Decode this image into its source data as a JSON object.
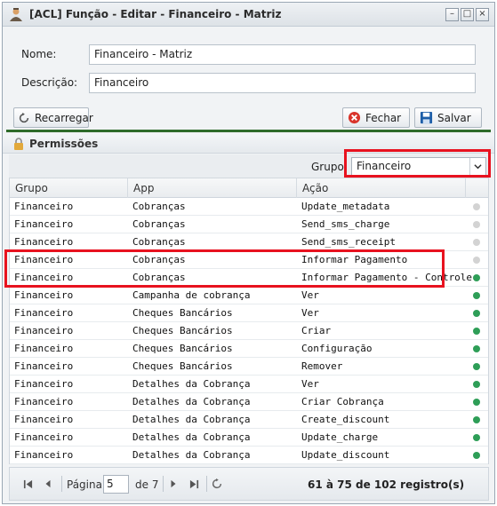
{
  "window": {
    "title": "[ACL] Função - Editar - Financeiro - Matriz",
    "controls": [
      "–",
      "□",
      "×"
    ]
  },
  "form": {
    "nome_label": "Nome:",
    "nome_value": "Financeiro - Matriz",
    "descricao_label": "Descrição:",
    "descricao_value": "Financeiro"
  },
  "toolbar": {
    "reload_label": "Recarregar",
    "close_label": "Fechar",
    "save_label": "Salvar"
  },
  "panel": {
    "title": "Permissões"
  },
  "filter": {
    "label": "Grupo:",
    "value": "Financeiro"
  },
  "columns": [
    "Grupo",
    "App",
    "Ação"
  ],
  "colors": {
    "active": "#2e9e57",
    "inactive": "#d3d3d3",
    "highlight": "#e8121f",
    "divider": "#2e6b2a"
  },
  "rows": [
    {
      "grupo": "Financeiro",
      "app": "Cobranças",
      "acao": "Update_metadata",
      "active": false
    },
    {
      "grupo": "Financeiro",
      "app": "Cobranças",
      "acao": "Send_sms_charge",
      "active": false
    },
    {
      "grupo": "Financeiro",
      "app": "Cobranças",
      "acao": "Send_sms_receipt",
      "active": false
    },
    {
      "grupo": "Financeiro",
      "app": "Cobranças",
      "acao": "Informar Pagamento",
      "active": false
    },
    {
      "grupo": "Financeiro",
      "app": "Cobranças",
      "acao": "Informar Pagamento - Controle",
      "active": true
    },
    {
      "grupo": "Financeiro",
      "app": "Campanha de cobrança",
      "acao": "Ver",
      "active": true
    },
    {
      "grupo": "Financeiro",
      "app": "Cheques Bancários",
      "acao": "Ver",
      "active": true
    },
    {
      "grupo": "Financeiro",
      "app": "Cheques Bancários",
      "acao": "Criar",
      "active": true
    },
    {
      "grupo": "Financeiro",
      "app": "Cheques Bancários",
      "acao": "Configuração",
      "active": true
    },
    {
      "grupo": "Financeiro",
      "app": "Cheques Bancários",
      "acao": "Remover",
      "active": true
    },
    {
      "grupo": "Financeiro",
      "app": "Detalhes da Cobrança",
      "acao": "Ver",
      "active": true
    },
    {
      "grupo": "Financeiro",
      "app": "Detalhes da Cobrança",
      "acao": "Criar Cobrança",
      "active": true
    },
    {
      "grupo": "Financeiro",
      "app": "Detalhes da Cobrança",
      "acao": "Create_discount",
      "active": true
    },
    {
      "grupo": "Financeiro",
      "app": "Detalhes da Cobrança",
      "acao": "Update_charge",
      "active": true
    },
    {
      "grupo": "Financeiro",
      "app": "Detalhes da Cobrança",
      "acao": "Update_discount",
      "active": true
    }
  ],
  "pager": {
    "page_label": "Página",
    "page_value": "5",
    "of_label": "de 7",
    "info": "61 à 75 de 102 registro(s)"
  }
}
